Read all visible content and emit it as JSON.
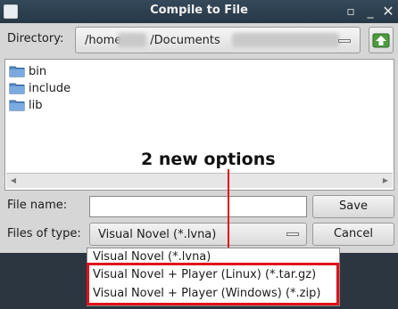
{
  "window": {
    "title": "Compile to File",
    "buttons": {
      "maximize": "▫",
      "minimize": "_",
      "close": "✕"
    }
  },
  "directory": {
    "label": "Directory:",
    "path_visible_start": "/home",
    "path_visible_mid": "/Documents"
  },
  "files": [
    {
      "name": "bin",
      "icon": "folder-icon"
    },
    {
      "name": "include",
      "icon": "folder-icon"
    },
    {
      "name": "lib",
      "icon": "folder-icon"
    }
  ],
  "file_name": {
    "label": "File name:",
    "value": ""
  },
  "files_of_type": {
    "label": "Files of type:",
    "selected": "Visual Novel (*.lvna)",
    "options": [
      "Visual Novel (*.lvna)",
      "Visual Novel + Player (Linux) (*.tar.gz)",
      "Visual Novel + Player (Windows) (*.zip)"
    ]
  },
  "buttons": {
    "save": "Save",
    "cancel": "Cancel"
  },
  "annotation": {
    "text": "2 new options"
  },
  "colors": {
    "highlight": "#e0101a",
    "titlebar": "#2e3f4d",
    "folder": "#5b8fc9"
  }
}
